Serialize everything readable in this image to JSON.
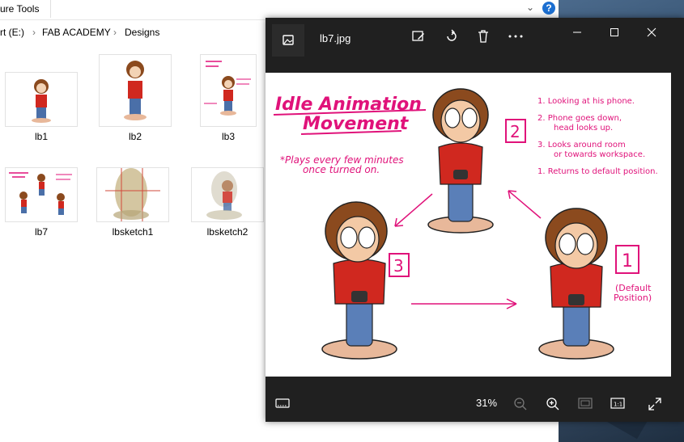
{
  "ribbon": {
    "title": "ure Tools",
    "help": "?",
    "expand": "⌄"
  },
  "address": {
    "crumbs": [
      "rt (E:)",
      "FAB ACADEMY",
      "Designs"
    ],
    "sep": "›"
  },
  "files": [
    {
      "name": "lb1"
    },
    {
      "name": "lb2"
    },
    {
      "name": "lb3"
    },
    {
      "name": "lb7"
    },
    {
      "name": "lbsketch1"
    },
    {
      "name": "lbsketch2"
    }
  ],
  "viewer": {
    "filename": "lb7.jpg",
    "zoom": "31%",
    "toolbar": [
      "edit-icon",
      "rotate-icon",
      "delete-icon",
      "more-icon"
    ],
    "window": [
      "minimize",
      "maximize",
      "close"
    ]
  },
  "artwork": {
    "title_line1": "Idle Animation",
    "title_line2": "Movement",
    "note_line1": "*Plays every few minutes",
    "note_line2": "once turned on.",
    "steps": [
      "1. Looking at his phone.",
      "2. Phone goes down,",
      "head looks up.",
      "3. Looks around room",
      "or towards workspace.",
      "1. Returns to default position."
    ],
    "label_default1": "(Default",
    "label_default2": "Position)",
    "num1": "1",
    "num2": "2",
    "num3": "3"
  },
  "colors": {
    "ink": "#e0127a",
    "viewer_bg": "#202020",
    "accent": "#1c6fd1"
  }
}
